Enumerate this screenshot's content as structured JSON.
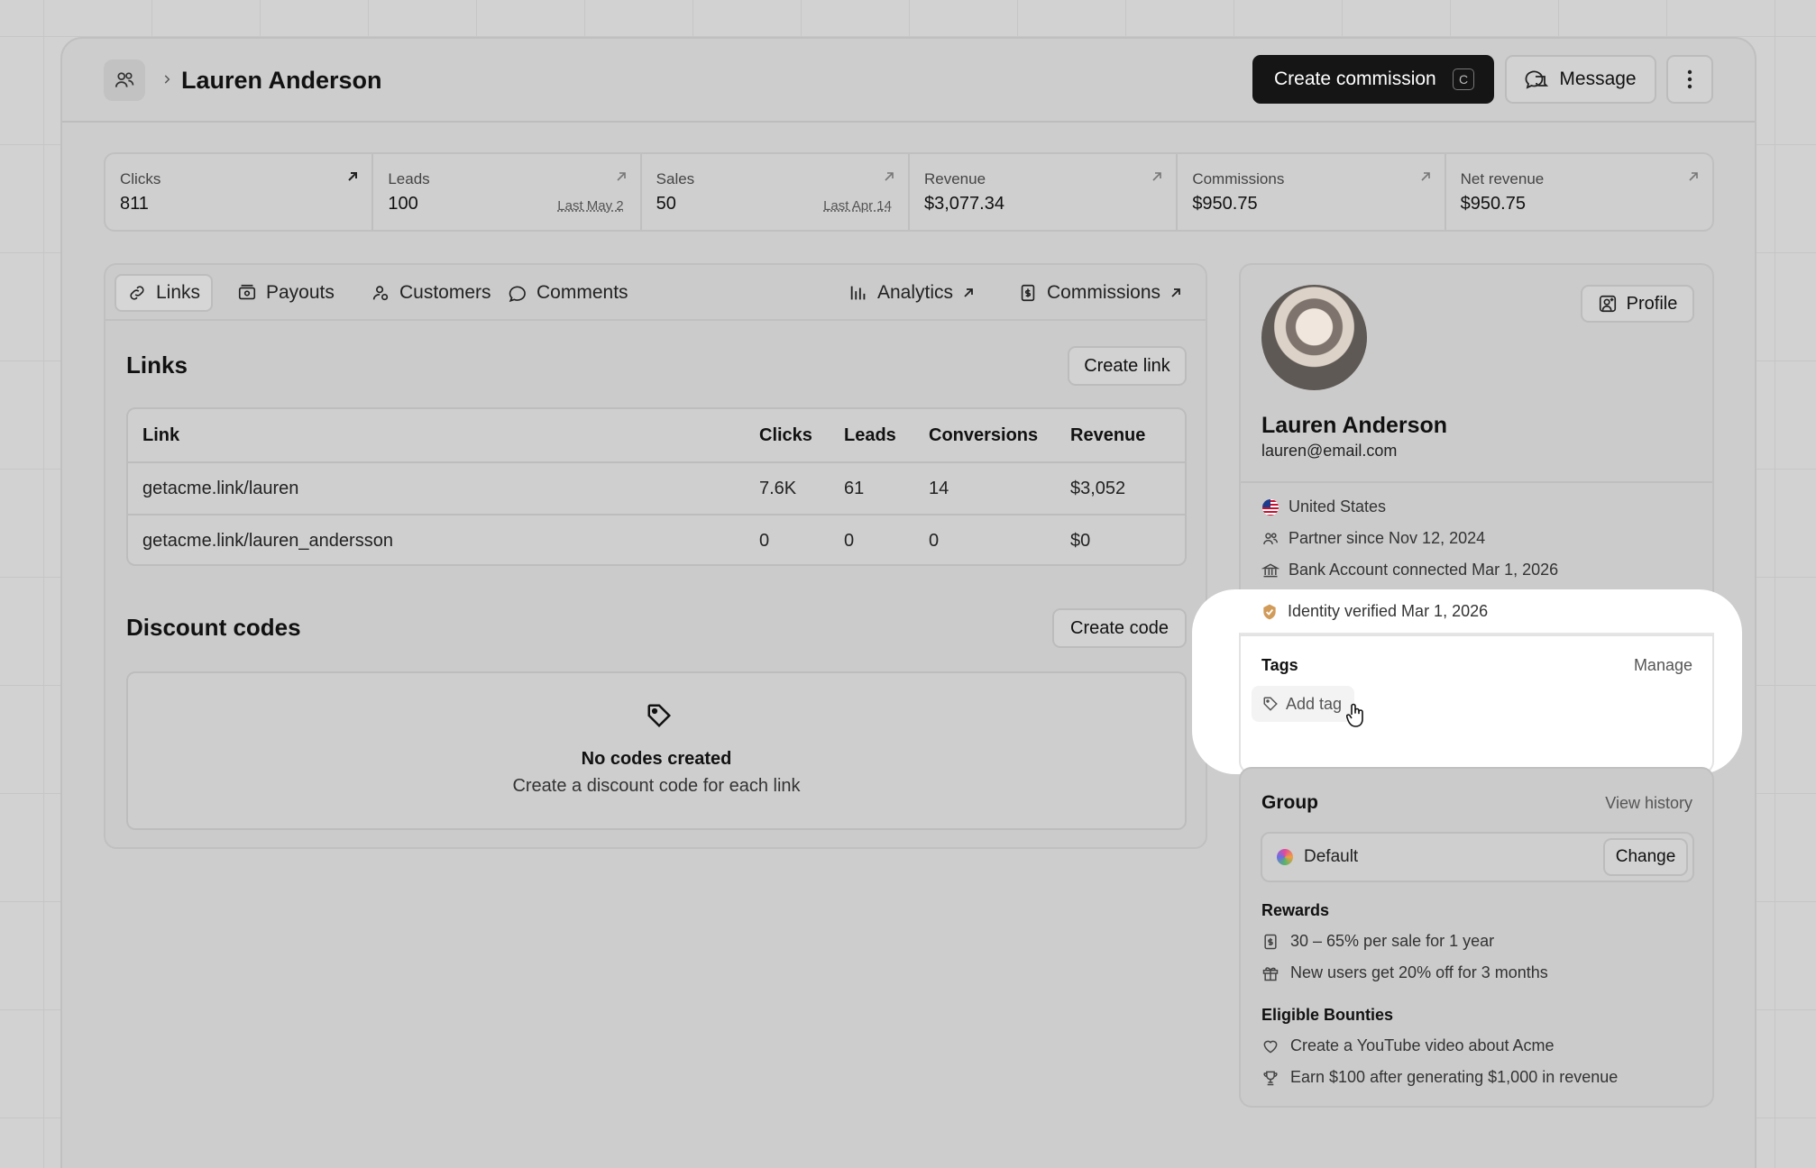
{
  "header": {
    "title": "Lauren Anderson",
    "create_commission_label": "Create commission",
    "create_commission_shortcut": "C",
    "message_label": "Message"
  },
  "stats": [
    {
      "label": "Clicks",
      "value": "811",
      "sub": ""
    },
    {
      "label": "Leads",
      "value": "100",
      "sub": "Last May 2"
    },
    {
      "label": "Sales",
      "value": "50",
      "sub": "Last Apr 14"
    },
    {
      "label": "Revenue",
      "value": "$3,077.34",
      "sub": ""
    },
    {
      "label": "Commissions",
      "value": "$950.75",
      "sub": ""
    },
    {
      "label": "Net revenue",
      "value": "$950.75",
      "sub": ""
    }
  ],
  "tabs": {
    "links": "Links",
    "payouts": "Payouts",
    "customers": "Customers",
    "comments": "Comments",
    "analytics": "Analytics",
    "commissions": "Commissions"
  },
  "links_section": {
    "title": "Links",
    "create_label": "Create link",
    "columns": [
      "Link",
      "Clicks",
      "Leads",
      "Conversions",
      "Revenue"
    ],
    "rows": [
      [
        "getacme.link/lauren",
        "7.6K",
        "61",
        "14",
        "$3,052"
      ],
      [
        "getacme.link/lauren_andersson",
        "0",
        "0",
        "0",
        "$0"
      ]
    ]
  },
  "discount_section": {
    "title": "Discount codes",
    "create_label": "Create code",
    "empty_title": "No codes created",
    "empty_subtitle": "Create a discount code for each link"
  },
  "partner": {
    "profile_label": "Profile",
    "name": "Lauren Anderson",
    "email": "lauren@email.com",
    "country": "United States",
    "partner_since": "Partner since Nov 12, 2024",
    "bank": "Bank Account connected Mar 1, 2026",
    "identity": "Identity verified Mar 1, 2026"
  },
  "tags": {
    "title": "Tags",
    "manage_label": "Manage",
    "add_label": "Add tag"
  },
  "group": {
    "title": "Group",
    "history_label": "View history",
    "name": "Default",
    "change_label": "Change",
    "rewards_title": "Rewards",
    "rewards": [
      "30 – 65% per sale for 1 year",
      "New users get 20% off for 3 months"
    ],
    "bounties_title": "Eligible Bounties",
    "bounties": [
      "Create a YouTube video about Acme",
      "Earn $100 after generating $1,000 in revenue"
    ]
  },
  "colors": {
    "primary_button": "#151515",
    "highlight": "#ffffff"
  }
}
